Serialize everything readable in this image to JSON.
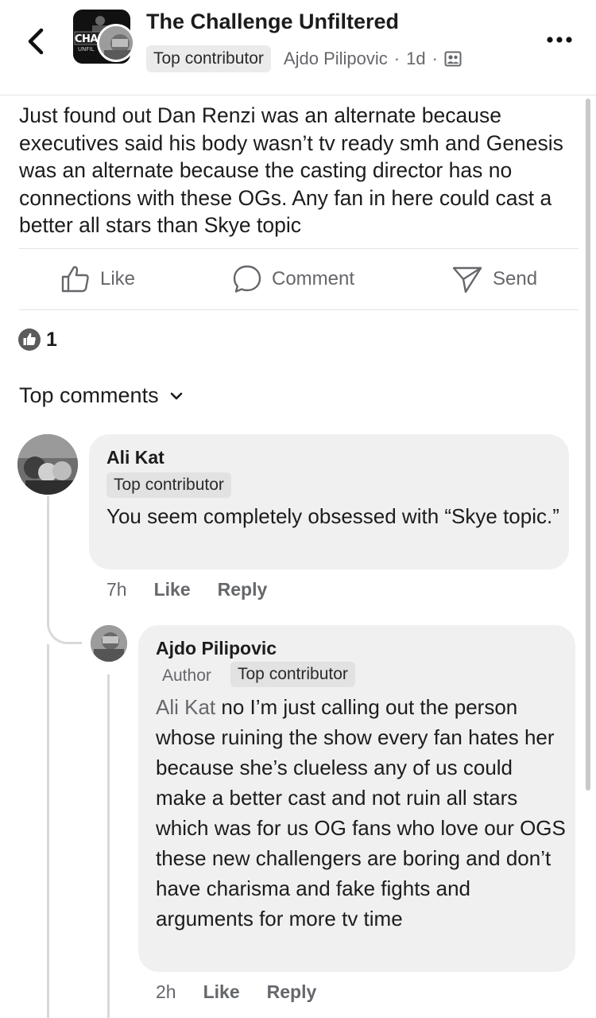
{
  "header": {
    "group_title": "The Challenge Unfiltered",
    "poster_badge": "Top contributor",
    "poster_name": "Ajdo Pilipovic",
    "dot": "·",
    "time": "1d",
    "logo_text": "CHAL",
    "logo_sub": "UNFIL"
  },
  "post": {
    "text": "Just found out Dan Renzi was an alternate because executives said his body wasn’t tv ready smh and Genesis was an alternate because the casting director has no connections with these OGs. Any fan in here could cast a better all stars than Skye topic"
  },
  "actions": {
    "like": "Like",
    "comment": "Comment",
    "send": "Send"
  },
  "reactions": {
    "count": "1"
  },
  "comments_sort": {
    "label": "Top comments"
  },
  "comments": [
    {
      "name": "Ali Kat",
      "badge": "Top contributor",
      "text": "You seem completely obsessed with “Skye topic.”",
      "time": "7h",
      "like": "Like",
      "reply": "Reply"
    },
    {
      "name": "Ajdo Pilipovic",
      "author_label": "Author",
      "badge": "Top contributor",
      "mention": "Ali Kat",
      "text": " no I’m just calling out the person whose ruining the show every fan hates her because she’s clueless any of us could make a better cast and not ruin all stars which was for us OG fans who love our OGS these new challengers are boring and don’t have charisma and fake fights and arguments for more tv time",
      "time": "2h",
      "like": "Like",
      "reply": "Reply"
    }
  ],
  "colors": {
    "text": "#1c1c1e",
    "secondary": "#65676b",
    "bubble": "#f0f0f0",
    "badge": "#ebebeb"
  }
}
